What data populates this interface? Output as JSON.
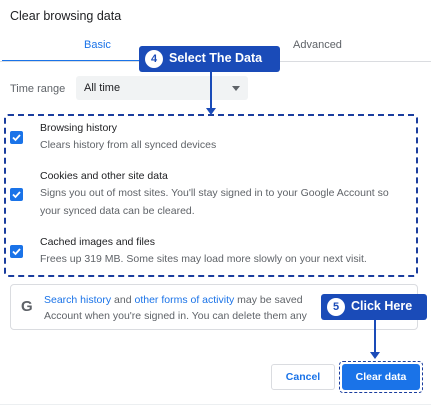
{
  "dialog": {
    "title": "Clear browsing data"
  },
  "tabs": [
    {
      "label": "Basic",
      "active": true
    },
    {
      "label": "Advanced",
      "active": false
    }
  ],
  "time_range": {
    "label": "Time range",
    "value": "All time"
  },
  "items": [
    {
      "title": "Browsing history",
      "desc": [
        "Clears history from all synced devices"
      ],
      "checked": true
    },
    {
      "title": "Cookies and other site data",
      "desc": [
        "Signs you out of most sites. You'll stay signed in to your Google Account so",
        "your synced data can be cleared."
      ],
      "checked": true
    },
    {
      "title": "Cached images and files",
      "desc": [
        "Frees up 319 MB. Some sites may load more slowly on your next visit."
      ],
      "checked": true
    }
  ],
  "google_note": {
    "icon": "G",
    "link1": "Search history",
    "and": " and ",
    "link2": "other forms of activity",
    "rest1": " may be saved",
    "line2": "Account when you're signed in. You can delete them any"
  },
  "buttons": {
    "cancel": "Cancel",
    "clear": "Clear data"
  },
  "callouts": [
    {
      "number": "4",
      "label": "Select The Data"
    },
    {
      "number": "5",
      "label": "Click Here"
    }
  ],
  "colors": {
    "accent": "#1a73e8",
    "callout": "#1a4bb8"
  }
}
